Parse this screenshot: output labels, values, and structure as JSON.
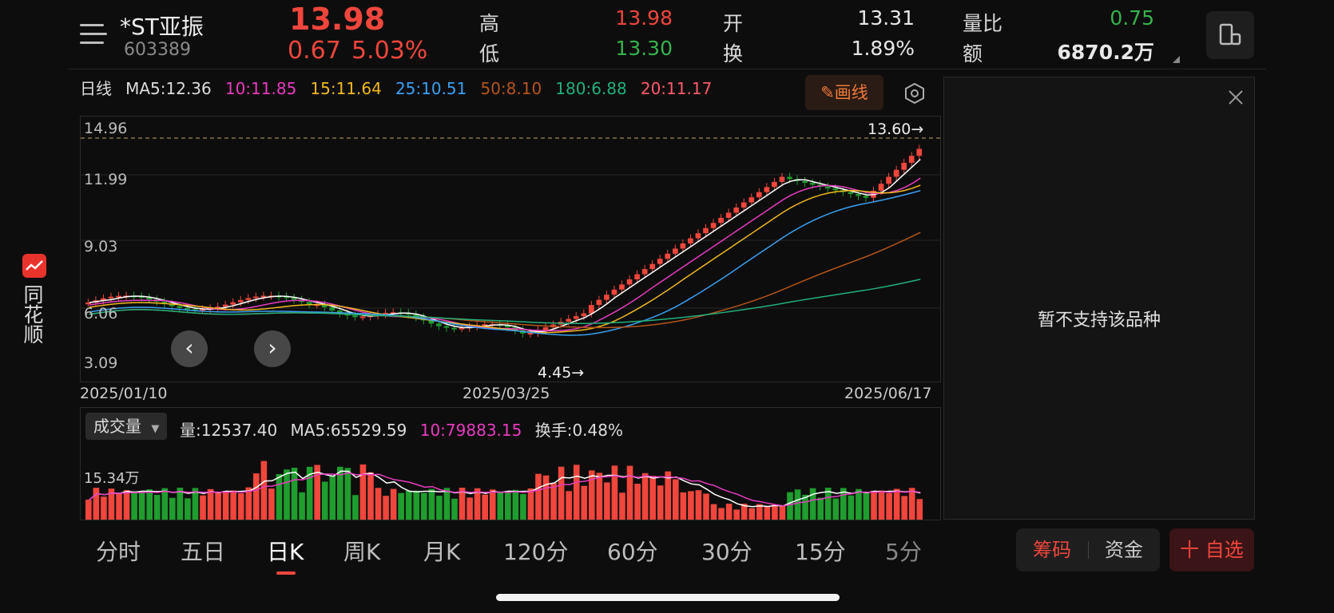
{
  "header": {
    "name": "*ST亚振",
    "code": "603389",
    "price": "13.98",
    "change": "0.67",
    "change_pct": "5.03%",
    "high_label": "高",
    "high": "13.98",
    "low_label": "低",
    "low": "13.30",
    "open_label": "开",
    "open": "13.31",
    "turnover_label": "换",
    "turnover": "1.89%",
    "volratio_label": "量比",
    "volratio": "0.75",
    "amount_label": "额",
    "amount": "6870.2万"
  },
  "sidebar": {
    "brand": "同花顺"
  },
  "ma_bar": {
    "period": "日线",
    "ma5": "MA5:12.36",
    "ma10": "10:11.85",
    "ma15": "15:11.64",
    "ma25": "25:10.51",
    "ma50": "50:8.10",
    "ma180": "180:6.88",
    "ma20": "20:11.17",
    "draw_button": "画线"
  },
  "kline": {
    "y_labels": [
      "14.96",
      "11.99",
      "9.03",
      "6.06",
      "3.09"
    ],
    "x_labels": [
      "2025/01/10",
      "2025/03/25",
      "2025/06/17"
    ],
    "max_marker": "13.60→",
    "min_marker": "4.45→"
  },
  "volume": {
    "selector": "成交量",
    "vol": "量:12537.40",
    "ma5": "MA5:65529.59",
    "ma10": "10:79883.15",
    "turnover": "换手:0.48%",
    "y_label": "15.34万"
  },
  "right_panel": {
    "message": "暂不支持该品种"
  },
  "tabs": [
    "分时",
    "五日",
    "日K",
    "周K",
    "月K",
    "120分",
    "60分",
    "30分",
    "15分",
    "5分"
  ],
  "buttons": {
    "chips": "筹码",
    "funds": "资金",
    "watchlist": "十 自选"
  },
  "colors": {
    "up": "#f0463c",
    "down": "#1f9d2e",
    "ma5": "#ffffff",
    "ma10": "#e83cc0",
    "ma15": "#f2b81f",
    "ma25": "#3aa0f2",
    "ma50": "#b5541a",
    "ma180": "#22b07a",
    "ma20": "#ff5a6e"
  }
}
